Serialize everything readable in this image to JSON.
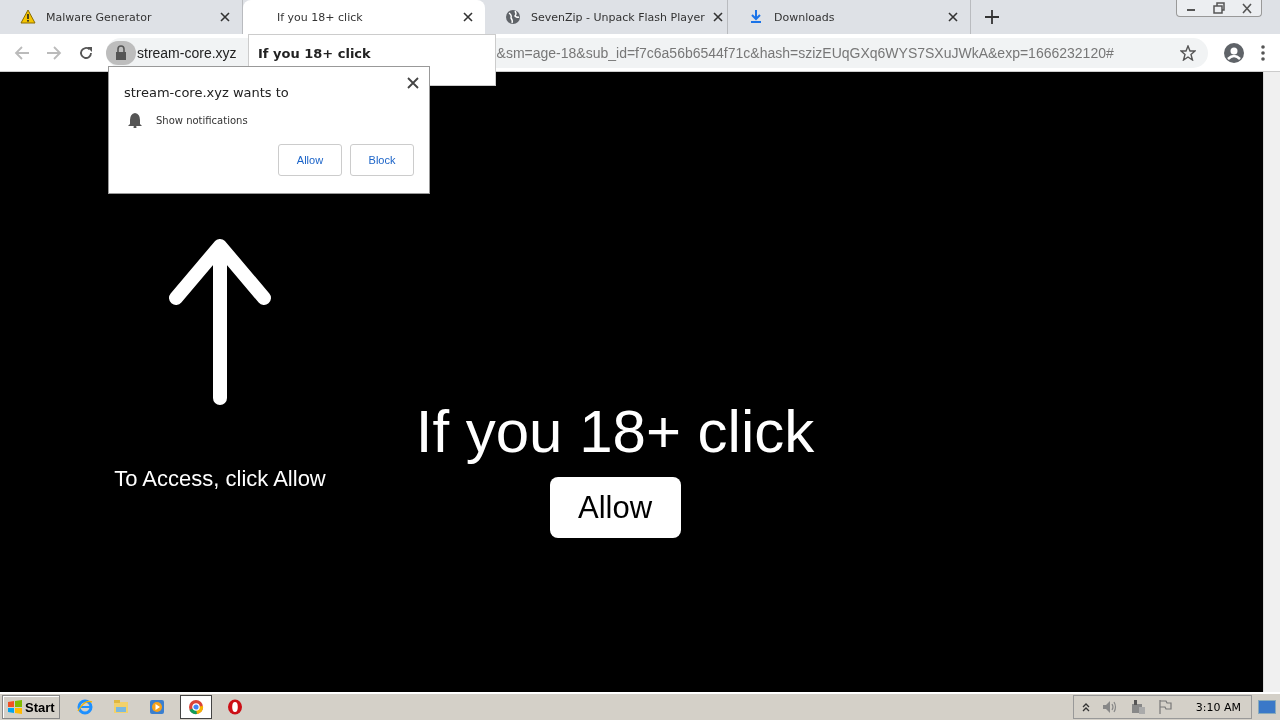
{
  "tabs": [
    {
      "title": "Malware Generator",
      "kind": "warning",
      "selected": false
    },
    {
      "title": "If you 18+ click",
      "kind": "blank",
      "selected": true
    },
    {
      "title": "SevenZip - Unpack Flash Player",
      "kind": "globe",
      "selected": false
    },
    {
      "title": "Downloads",
      "kind": "download",
      "selected": false
    }
  ],
  "address_bar": {
    "host": "stream-core.xyz",
    "query": "&sm=age-18&sub_id=f7c6a56b6544f71c&hash=szizEUqGXq6WYS7SXuJWkA&exp=1666232120#"
  },
  "tab_tooltip": {
    "title": "If you 18+ click"
  },
  "permission_popup": {
    "title": "stream-core.xyz wants to",
    "permission": "Show notifications",
    "buttons": [
      "Allow",
      "Block"
    ]
  },
  "page": {
    "hint": "To Access, click Allow",
    "heading": "If you 18+ click",
    "button": "Allow"
  },
  "taskbar": {
    "start": "Start",
    "apps": [
      {
        "kind": "ie",
        "selected": false
      },
      {
        "kind": "folder",
        "selected": false
      },
      {
        "kind": "media",
        "selected": false
      },
      {
        "kind": "chrome",
        "selected": true
      },
      {
        "kind": "opera",
        "selected": false
      }
    ],
    "clock": "3:10 AM"
  }
}
